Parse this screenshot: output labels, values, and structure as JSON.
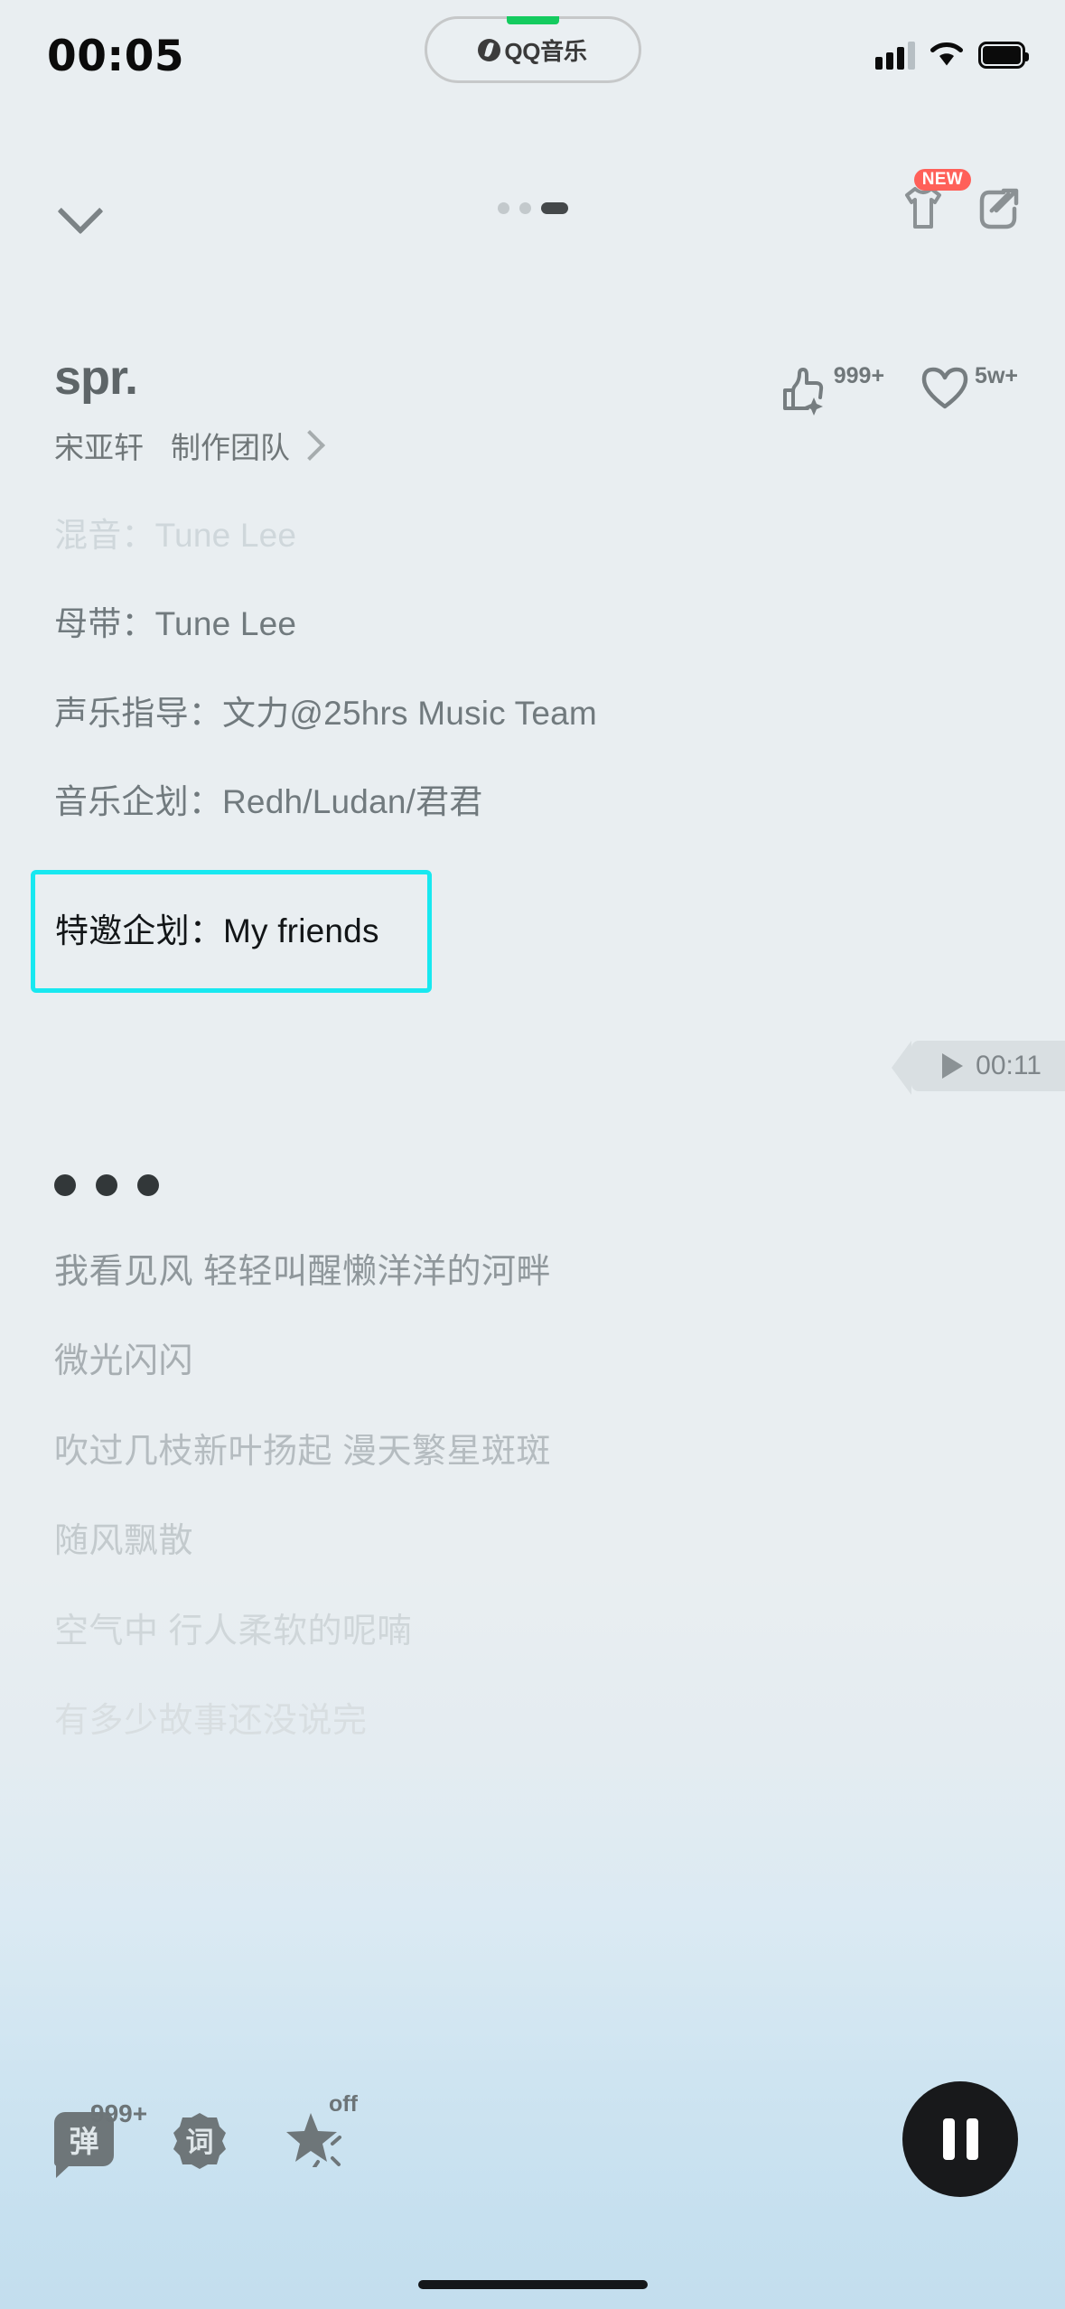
{
  "status_bar": {
    "time": "00:05",
    "island_app": "QQ音乐",
    "icons": [
      "cellular-signal-icon",
      "wifi-icon",
      "battery-icon"
    ]
  },
  "navbar": {
    "collapse_icon": "chevron-down-icon",
    "page_dots": [
      "dot",
      "dot",
      "dot-active"
    ],
    "tshirt_icon": "tshirt-icon",
    "tshirt_badge": "NEW",
    "share_icon": "share-icon"
  },
  "song": {
    "title": "spr.",
    "artist": "宋亚轩",
    "team_label": "制作团队",
    "like_count": "999+",
    "favorite_count": "5w+",
    "like_icon": "thumbs-up-sparkle-icon",
    "favorite_icon": "heart-icon"
  },
  "credits": [
    {
      "label": "混音：",
      "value": "Tune Lee",
      "state": "dim"
    },
    {
      "label": "母带：",
      "value": "Tune Lee",
      "state": "normal"
    },
    {
      "label": "声乐指导：",
      "value": "文力@25hrs Music Team",
      "state": "normal"
    },
    {
      "label": "音乐企划：",
      "value": "Redh/Ludan/君君",
      "state": "normal"
    },
    {
      "label": "特邀企划：",
      "value": "My friends",
      "state": "active"
    }
  ],
  "time_pill": {
    "time": "00:11",
    "play_icon": "play-icon"
  },
  "lyrics": [
    "我看见风 轻轻叫醒懒洋洋的河畔",
    "微光闪闪",
    "吹过几枝新叶扬起 漫天繁星斑斑",
    "随风飘散",
    "空气中 行人柔软的呢喃",
    "有多少故事还没说完"
  ],
  "bottom_bar": {
    "danmu_label": "弹",
    "danmu_count": "999+",
    "lyric_label": "词",
    "effect_icon": "star-sparkle-icon",
    "effect_state": "off",
    "pause_icon": "pause-icon"
  },
  "colors": {
    "highlight_border": "#18e8f0",
    "badge_red": "#ff6059",
    "island_green": "#14cb5f",
    "background_top": "#e9eef1",
    "background_bottom": "#c3deee"
  }
}
